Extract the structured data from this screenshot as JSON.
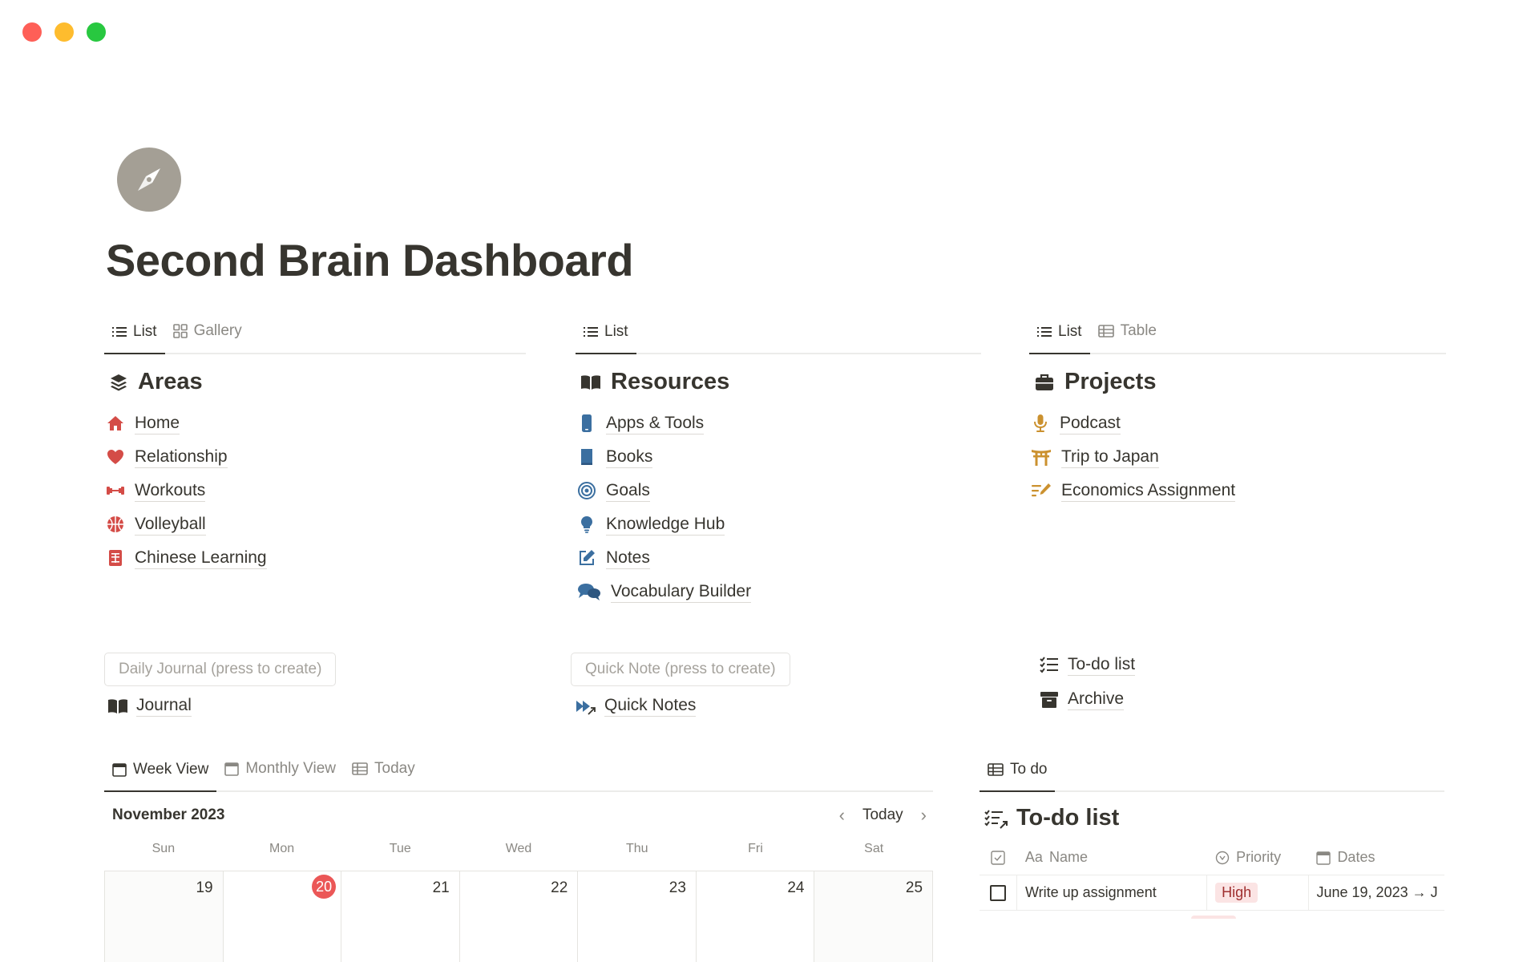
{
  "page": {
    "title": "Second Brain Dashboard",
    "icon": "compass-icon"
  },
  "areas": {
    "tabs": [
      {
        "label": "List",
        "icon": "list-icon",
        "active": true
      },
      {
        "label": "Gallery",
        "icon": "gallery-icon",
        "active": false
      }
    ],
    "title": "Areas",
    "icon": "layers-icon",
    "items": [
      {
        "label": "Home",
        "icon": "house-icon"
      },
      {
        "label": "Relationship",
        "icon": "heart-icon"
      },
      {
        "label": "Workouts",
        "icon": "dumbbell-icon"
      },
      {
        "label": "Volleyball",
        "icon": "ball-icon"
      },
      {
        "label": "Chinese Learning",
        "icon": "hanzi-icon"
      }
    ],
    "accent": "#d44c47"
  },
  "resources": {
    "tabs": [
      {
        "label": "List",
        "icon": "list-icon",
        "active": true
      }
    ],
    "title": "Resources",
    "icon": "open-book-icon",
    "items": [
      {
        "label": "Apps & Tools",
        "icon": "phone-icon"
      },
      {
        "label": "Books",
        "icon": "book-icon"
      },
      {
        "label": "Goals",
        "icon": "target-icon"
      },
      {
        "label": "Knowledge Hub",
        "icon": "lightbulb-icon"
      },
      {
        "label": "Notes",
        "icon": "edit-icon"
      },
      {
        "label": "Vocabulary Builder",
        "icon": "chat-bubbles-icon"
      }
    ],
    "accent": "#3b6fa0"
  },
  "projects": {
    "tabs": [
      {
        "label": "List",
        "icon": "list-icon",
        "active": true
      },
      {
        "label": "Table",
        "icon": "table-icon",
        "active": false
      }
    ],
    "title": "Projects",
    "icon": "briefcase-icon",
    "items": [
      {
        "label": "Podcast",
        "icon": "microphone-icon"
      },
      {
        "label": "Trip to Japan",
        "icon": "torii-icon"
      },
      {
        "label": "Economics Assignment",
        "icon": "write-list-icon"
      }
    ],
    "accent": "#cb912f"
  },
  "quick_actions": {
    "daily_journal_button": "Daily Journal (press to create)",
    "journal_link": "Journal",
    "quick_note_button": "Quick Note (press to create)",
    "quick_notes_link": "Quick Notes",
    "todo_link": "To-do list",
    "archive_link": "Archive"
  },
  "calendar": {
    "tabs": [
      {
        "label": "Week View",
        "active": true
      },
      {
        "label": "Monthly View",
        "active": false
      },
      {
        "label": "Today",
        "active": false
      }
    ],
    "month": "November 2023",
    "today_button": "Today",
    "weekdays": [
      "Sun",
      "Mon",
      "Tue",
      "Wed",
      "Thu",
      "Fri",
      "Sat"
    ],
    "dates": [
      "19",
      "20",
      "21",
      "22",
      "23",
      "24",
      "25"
    ],
    "today_date": "20",
    "today_color": "#eb5757"
  },
  "todo": {
    "tabs": [
      {
        "label": "To do",
        "active": true
      }
    ],
    "title": "To-do list",
    "columns": [
      "Name",
      "Priority",
      "Dates"
    ],
    "name_prefix": "Aa",
    "rows": [
      {
        "checked": false,
        "name": "Write up assignment",
        "priority": "High",
        "dates": "June 19, 2023 → J"
      }
    ]
  }
}
